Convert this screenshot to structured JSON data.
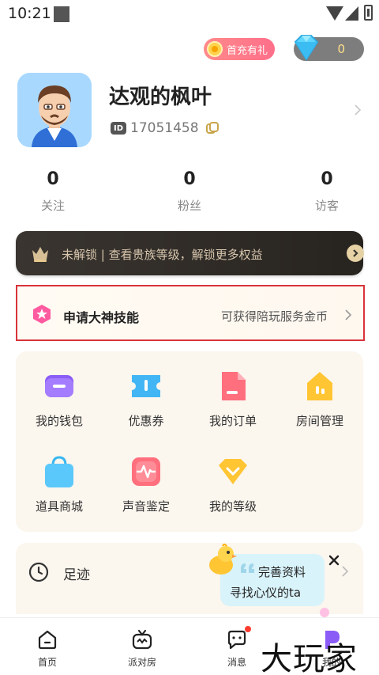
{
  "status_bar": {
    "time": "10:21"
  },
  "header": {
    "first_charge_label": "首充有礼",
    "diamond_count": "0"
  },
  "profile": {
    "username": "达观的枫叶",
    "id_badge": "ID",
    "user_id": "17051458"
  },
  "stats": [
    {
      "value": "0",
      "label": "关注"
    },
    {
      "value": "0",
      "label": "粉丝"
    },
    {
      "value": "0",
      "label": "访客"
    }
  ],
  "vip_bar": {
    "text": "未解锁 | 查看贵族等级，解锁更多权益"
  },
  "apply": {
    "title": "申请大神技能",
    "subtitle": "可获得陪玩服务金币"
  },
  "grid": [
    {
      "label": "我的钱包",
      "icon": "wallet-icon"
    },
    {
      "label": "优惠券",
      "icon": "coupon-icon"
    },
    {
      "label": "我的订单",
      "icon": "order-icon"
    },
    {
      "label": "房间管理",
      "icon": "room-manage-icon"
    },
    {
      "label": "道具商城",
      "icon": "shop-icon"
    },
    {
      "label": "声音鉴定",
      "icon": "voice-icon"
    },
    {
      "label": "我的等级",
      "icon": "level-icon"
    }
  ],
  "footprint": {
    "label": "足迹"
  },
  "bubble": {
    "line1": "完善资料",
    "line2": "寻找心仪的ta"
  },
  "tabbar": [
    {
      "label": "首页",
      "icon": "home-icon"
    },
    {
      "label": "派对房",
      "icon": "party-tv-icon"
    },
    {
      "label": "消息",
      "icon": "message-icon"
    },
    {
      "label": "我的",
      "icon": "profile-icon"
    }
  ],
  "watermark": "大玩家",
  "colors": {
    "accent_red": "#d9333b",
    "card_bg": "#fbf6ee",
    "vip_dark": "#2f2a26",
    "bubble_bg": "#d9f3fa"
  }
}
